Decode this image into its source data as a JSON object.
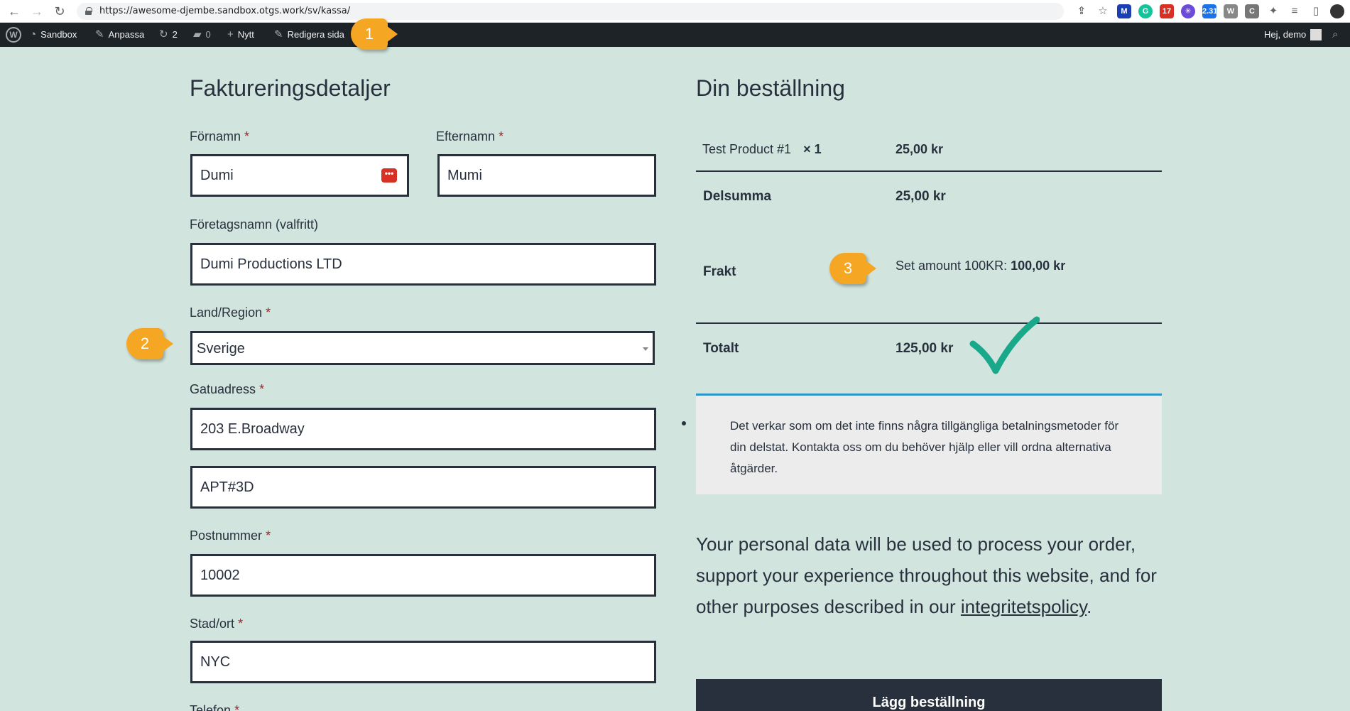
{
  "browser": {
    "url": "https://awesome-djembe.sandbox.otgs.work/sv/kassa/",
    "extension_badges": [
      "17",
      "2.31"
    ],
    "extension_letters": [
      "W",
      "C"
    ]
  },
  "adminbar": {
    "site": "Sandbox",
    "customize": "Anpassa",
    "updates": "2",
    "comments": "0",
    "new": "Nytt",
    "edit": "Redigera sida",
    "greeting": "Hej, demo"
  },
  "annotations": {
    "badge1": "1",
    "badge2": "2",
    "badge3": "3"
  },
  "billing": {
    "title": "Faktureringsdetaljer",
    "first_name_label": "Förnamn",
    "first_name": "Dumi",
    "last_name_label": "Efternamn",
    "last_name": "Mumi",
    "company_label": "Företagsnamn (valfritt)",
    "company": "Dumi Productions LTD",
    "country_label": "Land/Region",
    "country": "Sverige",
    "street_label": "Gatuadress",
    "street1": "203 E.Broadway",
    "street2": "APT#3D",
    "postcode_label": "Postnummer",
    "postcode": "10002",
    "city_label": "Stad/ort",
    "city": "NYC",
    "phone_label": "Telefon",
    "required_mark": "*"
  },
  "order": {
    "title": "Din beställning",
    "product_name": "Test Product #1",
    "product_qty": "× 1",
    "product_total": "25,00 kr",
    "subtotal_label": "Delsumma",
    "subtotal": "25,00 kr",
    "shipping_label": "Frakt",
    "shipping_method": "Set amount 100KR:",
    "shipping_cost": "100,00 kr",
    "total_label": "Totalt",
    "total": "125,00 kr",
    "notice": "Det verkar som om det inte finns några tillgängliga betalningsmetoder för din delstat. Kontakta oss om du behöver hjälp eller vill ordna alternativa åtgärder.",
    "privacy_text": "Your personal data will be used to process your order, support your experience throughout this website, and for other purposes described in our",
    "privacy_link": "integritetspolicy",
    "privacy_end": ".",
    "place_order": "Lägg beställning"
  }
}
